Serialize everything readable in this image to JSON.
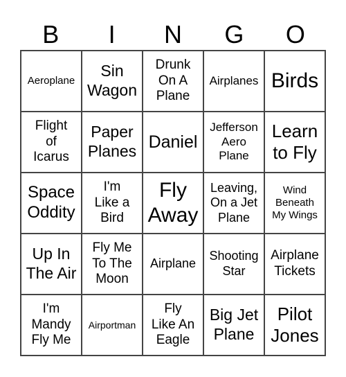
{
  "header": [
    "B",
    "I",
    "N",
    "G",
    "O"
  ],
  "cells": [
    "Aeroplane",
    "Sin\nWagon",
    "Drunk\nOn A\nPlane",
    "Airplanes",
    "Birds",
    "Flight\nof\nIcarus",
    "Paper\nPlanes",
    "Daniel",
    "Jefferson\nAero\nPlane",
    "Learn\nto Fly",
    "Space\nOddity",
    "I'm\nLike a\nBird",
    "Fly\nAway",
    "Leaving,\nOn a Jet\nPlane",
    "Wind\nBeneath\nMy Wings",
    "Up In\nThe Air",
    "Fly Me\nTo The\nMoon",
    "Airplane",
    "Shooting\nStar",
    "Airplane\nTickets",
    "I'm\nMandy\nFly Me",
    "Airportman",
    "Fly\nLike An\nEagle",
    "Big Jet\nPlane",
    "Pilot\nJones"
  ]
}
